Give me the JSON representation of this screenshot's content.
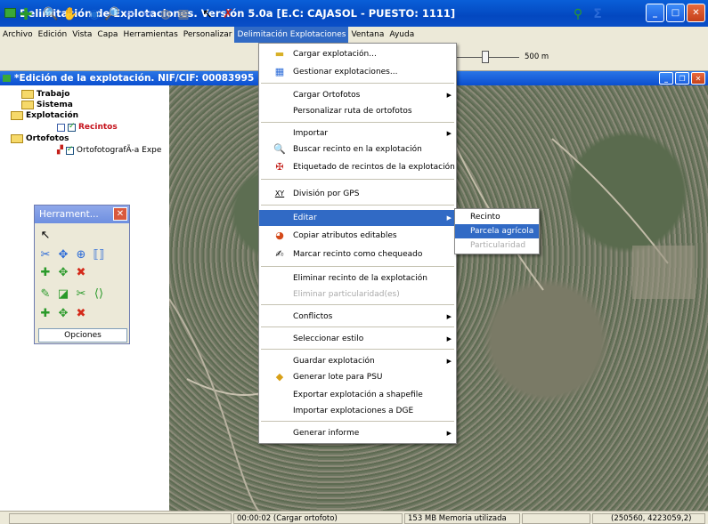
{
  "window": {
    "title": "Delimitación de Explotaciones. Versión 5.0a   [E.C: CAJASOL - PUESTO: 1111]"
  },
  "menubar": [
    "Archivo",
    "Edición",
    "Vista",
    "Capa",
    "Herramientas",
    "Personalizar",
    "Delimitación Explotaciones",
    "Ventana",
    "Ayuda"
  ],
  "toolbar": {
    "scale_label": "500 m"
  },
  "document": {
    "title": "*Edición de la explotación. NIF/CIF: 00083995"
  },
  "tree": {
    "trabajo": "Trabajo",
    "sistema": "Sistema",
    "explotacion": "Explotación",
    "recintos": "Recintos",
    "ortofotos": "Ortofotos",
    "ortofoto_layer": "OrtofotografÃ-a Expe"
  },
  "tools_panel": {
    "title": "Herrament...",
    "opciones": "Opciones"
  },
  "menu": {
    "items": [
      {
        "label": "Cargar explotación...",
        "icon": "folder-open-icon"
      },
      {
        "label": "Gestionar explotaciones...",
        "icon": "table-icon"
      },
      {
        "label": "Cargar Ortofotos",
        "submenu": true
      },
      {
        "label": "Personalizar ruta de ortofotos"
      },
      {
        "label": "Importar",
        "submenu": true
      },
      {
        "label": "Buscar recinto en la explotación",
        "icon": "magnifier-icon"
      },
      {
        "label": "Etiquetado de recintos de la explotación",
        "icon": "pin-icon"
      },
      {
        "label": "División por GPS",
        "icon": "xy-icon"
      },
      {
        "label": "Editar",
        "submenu": true,
        "highlighted": true
      },
      {
        "label": "Copiar atributos editables",
        "icon": "palette-icon"
      },
      {
        "label": "Marcar recinto como chequeado",
        "icon": "check-stamp-icon"
      },
      {
        "label": "Eliminar recinto de la explotación"
      },
      {
        "label": "Eliminar particularidad(es)",
        "disabled": true
      },
      {
        "label": "Conflictos",
        "submenu": true
      },
      {
        "label": "Seleccionar estilo",
        "submenu": true
      },
      {
        "label": "Guardar explotación",
        "submenu": true
      },
      {
        "label": "Generar lote para PSU",
        "icon": "package-icon"
      },
      {
        "label": "Exportar explotación a shapefile"
      },
      {
        "label": "Importar explotaciones a DGE"
      },
      {
        "label": "Generar informe",
        "submenu": true
      }
    ]
  },
  "submenu": {
    "items": [
      {
        "label": "Recinto"
      },
      {
        "label": "Parcela agrícola",
        "highlighted": true
      },
      {
        "label": "Particularidad",
        "disabled": true
      }
    ]
  },
  "status": {
    "time": "00:00:02 (Cargar ortofoto)",
    "memory": "153 MB Memoria utilizada",
    "coords": "(250560, 4223059,2)"
  }
}
